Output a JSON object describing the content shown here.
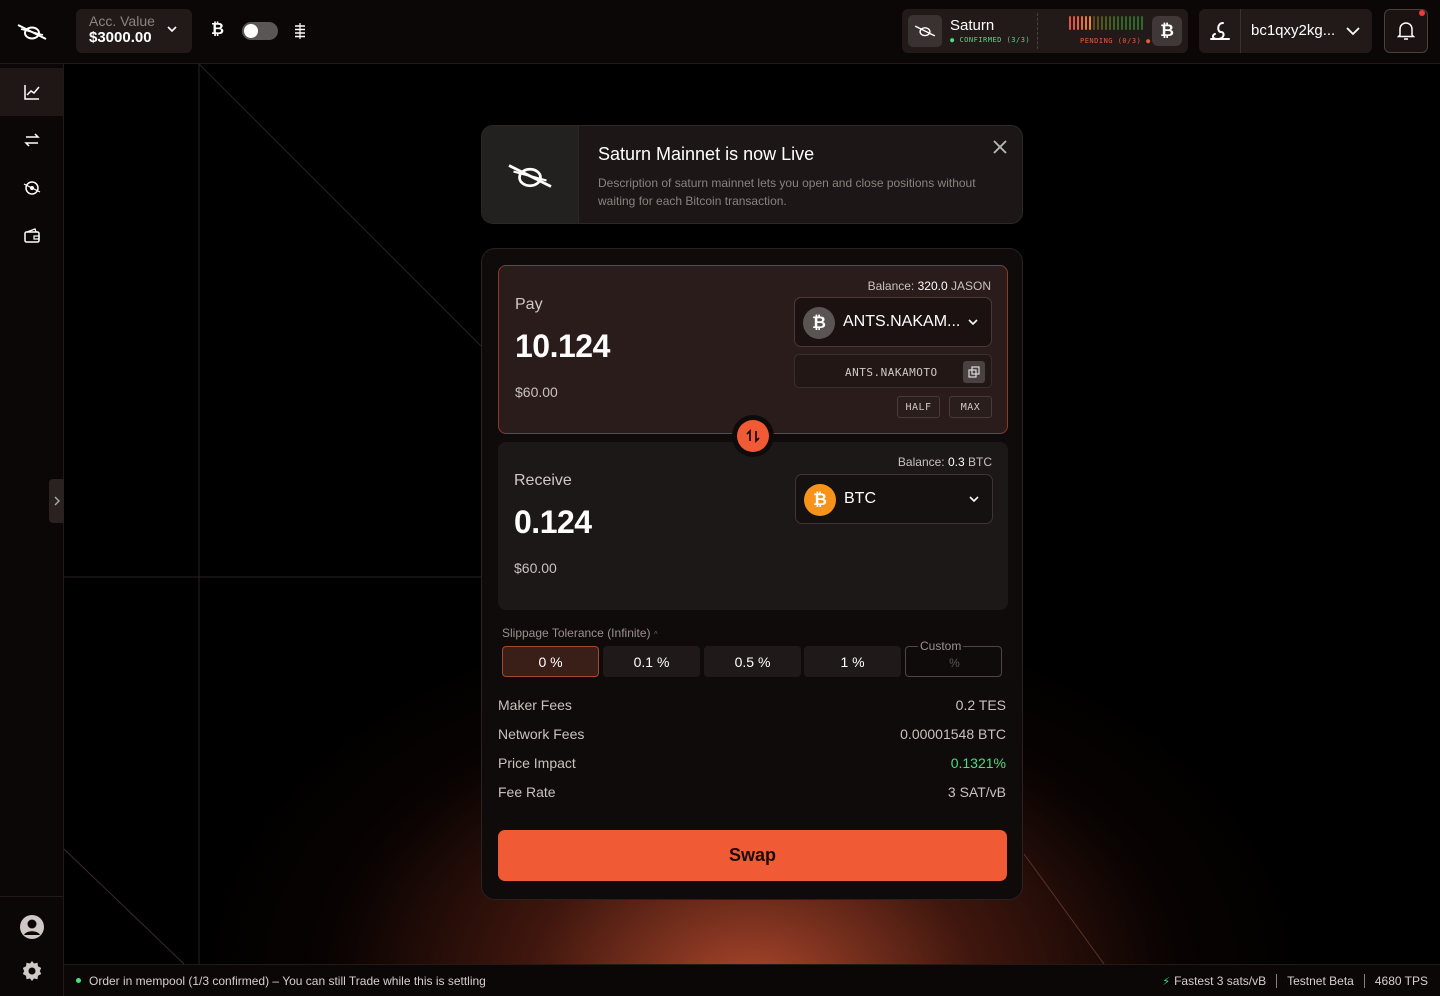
{
  "header": {
    "acc_value_label": "Acc. Value",
    "acc_value": "$3000.00",
    "btc_symbol": "₿",
    "network": {
      "name": "Saturn",
      "confirmed": "CONFIRMED (3/3)",
      "pending": "PENDING (0/3)"
    },
    "wallet_address": "bc1qxy2kg...",
    "colors": {
      "accent": "#f05a34",
      "confirmed": "#4ade80"
    }
  },
  "sidebar": {
    "items": [
      {
        "icon": "chart-icon"
      },
      {
        "icon": "swap-arrows-icon"
      },
      {
        "icon": "pool-icon"
      },
      {
        "icon": "wallet-icon"
      }
    ],
    "bottom": [
      {
        "icon": "user-icon"
      },
      {
        "icon": "gear-icon"
      }
    ]
  },
  "banner": {
    "title": "Saturn Mainnet is now Live",
    "description": "Description of saturn mainnet lets you open and close positions without waiting for each Bitcoin transaction."
  },
  "swap": {
    "pay": {
      "label": "Pay",
      "amount": "10.124",
      "usd": "$60.00",
      "balance_label": "Balance:",
      "balance_value": "320.0",
      "balance_unit": "JASON",
      "token": "ANTS.NAKAM...",
      "ticker": "ANTS.NAKAMOTO",
      "half": "HALF",
      "max": "MAX"
    },
    "receive": {
      "label": "Receive",
      "amount": "0.124",
      "usd": "$60.00",
      "balance_label": "Balance:",
      "balance_value": "0.3",
      "balance_unit": "BTC",
      "token": "BTC"
    },
    "slippage": {
      "title": "Slippage Tolerance (Infinite)",
      "options": [
        "0 %",
        "0.1 %",
        "0.5 %",
        "1 %"
      ],
      "custom_label": "Custom",
      "custom_placeholder": "%"
    },
    "fees": [
      {
        "label": "Maker Fees",
        "value": "0.2 TES"
      },
      {
        "label": "Network Fees",
        "value": "0.00001548 BTC"
      },
      {
        "label": "Price Impact",
        "value": "0.1321%"
      },
      {
        "label": "Fee Rate",
        "value": "3 SAT/vB"
      }
    ],
    "swap_button": "Swap"
  },
  "statusbar": {
    "message": "Order in mempool (1/3 confirmed) – You can still Trade while this is settling",
    "fastest": "Fastest 3 sats/vB",
    "network": "Testnet Beta",
    "tps": "4680 TPS"
  }
}
